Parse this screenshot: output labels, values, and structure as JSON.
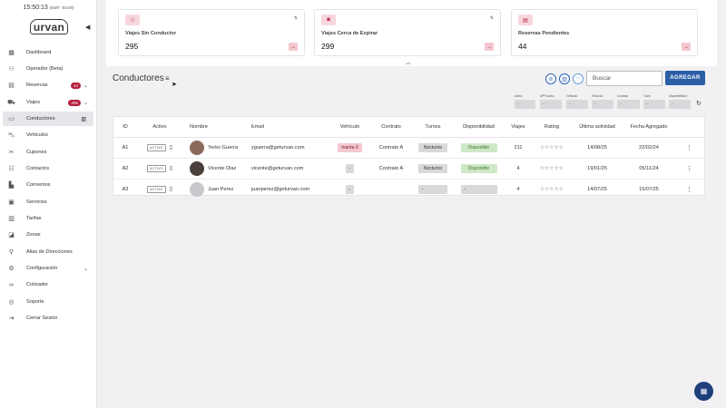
{
  "clock": {
    "time": "15:50:13",
    "timezone": "(GMT -04:00)"
  },
  "brand": {
    "logo_text": "urvan"
  },
  "sidebar": {
    "items": [
      {
        "label": "Dashboard",
        "icon": "dashboard-icon",
        "glyph": "▦"
      },
      {
        "label": "Operador (Beta)",
        "icon": "operator-icon",
        "glyph": "⚇"
      },
      {
        "label": "Reservas",
        "icon": "reservations-icon",
        "glyph": "▤",
        "badge": "44"
      },
      {
        "label": "Viajes",
        "icon": "trips-icon",
        "glyph": "⛟",
        "badge": "295"
      },
      {
        "label": "Conductores",
        "icon": "drivers-icon",
        "glyph": "▭"
      },
      {
        "label": "Vehiculos",
        "icon": "vehicle-icon",
        "glyph": "⛍"
      },
      {
        "label": "Cupones",
        "icon": "coupon-icon",
        "glyph": "✂"
      },
      {
        "label": "Contactos",
        "icon": "contacts-icon",
        "glyph": "☷"
      },
      {
        "label": "Convenios",
        "icon": "agreements-icon",
        "glyph": "▙"
      },
      {
        "label": "Servicios",
        "icon": "services-icon",
        "glyph": "▣"
      },
      {
        "label": "Tarifas",
        "icon": "rates-icon",
        "glyph": "▥"
      },
      {
        "label": "Zonas",
        "icon": "zones-icon",
        "glyph": "◪"
      },
      {
        "label": "Alias de Direcciones",
        "icon": "location-pin-icon",
        "glyph": "⚲"
      },
      {
        "label": "Configuración",
        "icon": "gear-icon",
        "glyph": "⚙"
      },
      {
        "label": "Cotizador",
        "icon": "link-icon",
        "glyph": "∞"
      },
      {
        "label": "Soporte",
        "icon": "support-icon",
        "glyph": "◎"
      },
      {
        "label": "Cerrar Sesión",
        "icon": "logout-icon",
        "glyph": "⇥"
      }
    ]
  },
  "stats": [
    {
      "title": "Viajes Sin Conductor",
      "value": "295",
      "icon": "person-add-icon"
    },
    {
      "title": "Viajes Cerca de Expirar",
      "value": "299",
      "icon": "camera-icon"
    },
    {
      "title": "Reservas Pendientes",
      "value": "44",
      "icon": "document-icon"
    }
  ],
  "header": {
    "title": "Conductores",
    "search_placeholder": "Buscar",
    "add_label": "AGREGAR"
  },
  "filters": [
    {
      "label": "Activo",
      "value": "-"
    },
    {
      "label": "APP Activo",
      "value": "-"
    },
    {
      "label": "Vehículo",
      "value": "-"
    },
    {
      "label": "Vehículo",
      "value": "-"
    },
    {
      "label": "Contrato",
      "value": "-"
    },
    {
      "label": "Turno",
      "value": "-"
    },
    {
      "label": "Disponibilidad",
      "value": "-"
    }
  ],
  "table": {
    "columns": [
      "ID",
      "Activo",
      "Nombre",
      "Email",
      "Vehículo",
      "Contrato",
      "Turnos",
      "Disponibilidad",
      "Viajes",
      "Rating",
      "Última actividad",
      "Fecha Agregado"
    ],
    "rows": [
      {
        "id": "A1",
        "status": "ACTIVO",
        "name": "Yerko Guerra",
        "email": "yguerra@geturvan.com",
        "vehicle": "manta-3",
        "contract": "Contrato A",
        "shift": "Nocturno",
        "availability": "Disponible",
        "trips": "211",
        "rating": "☆☆☆☆☆",
        "last_activity": "14/08/25",
        "added": "22/02/24",
        "avatar_color": "#8a6a5a"
      },
      {
        "id": "A2",
        "status": "ACTIVO",
        "name": "Vicente Diaz",
        "email": "vicente@geturvan.com",
        "vehicle": "-",
        "contract": "Contrato A",
        "shift": "Nocturno",
        "availability": "Disponible",
        "trips": "4",
        "rating": "☆☆☆☆☆",
        "last_activity": "19/01/25",
        "added": "05/11/24",
        "avatar_color": "#4a3f3a"
      },
      {
        "id": "A3",
        "status": "ACTIVO",
        "name": "Juan Perez",
        "email": "juanperez@geturvan.com",
        "vehicle": "-",
        "contract": "",
        "shift": "-",
        "availability": "-",
        "trips": "4",
        "rating": "☆☆☆☆☆",
        "last_activity": "14/07/25",
        "added": "15/07/25",
        "avatar_color": "#c8c8cc"
      }
    ]
  },
  "colors": {
    "accent": "#2a5fa8",
    "brand": "#b41e3c",
    "fab": "#1f3f7a"
  }
}
